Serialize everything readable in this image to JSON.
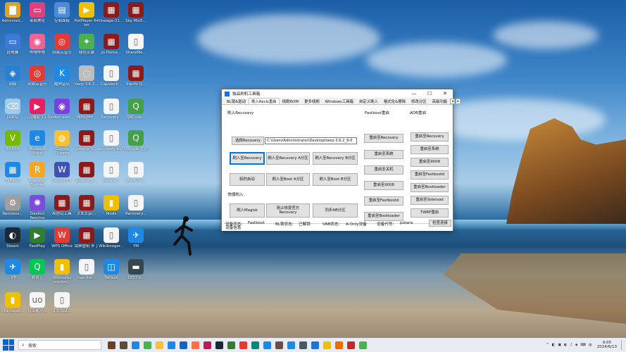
{
  "desktop": {
    "icons": [
      {
        "label": "Administr...",
        "color": "#e0a020",
        "glyph": "▇"
      },
      {
        "label": "桌面美化",
        "color": "#e04080",
        "glyph": "▭"
      },
      {
        "label": "控制面板",
        "color": "#4a8ad8",
        "glyph": "▤"
      },
      {
        "label": "PotPlayer 64 bit",
        "color": "#f0c000",
        "glyph": "▶"
      },
      {
        "label": "lineage-21...",
        "color": "#8b1a1a",
        "glyph": "▦"
      },
      {
        "label": "Sky Mix5...",
        "color": "#8b1a1a",
        "glyph": "▦"
      },
      {
        "label": "此电脑",
        "color": "#3a7bd5",
        "glyph": "▭"
      },
      {
        "label": "哔哩哔哩",
        "color": "#f06292",
        "glyph": "◉"
      },
      {
        "label": "网易云音乐",
        "color": "#e53935",
        "glyph": "◎"
      },
      {
        "label": "绿色安装",
        "color": "#4caf50",
        "glyph": "✦"
      },
      {
        "label": "pl.Home...",
        "color": "#8b1a1a",
        "glyph": "▦"
      },
      {
        "label": "ShareMe...",
        "color": "#f5f5f5",
        "glyph": "▯"
      },
      {
        "label": "网络",
        "color": "#2a7fd4",
        "glyph": "◈"
      },
      {
        "label": "网易云音乐",
        "color": "#e53935",
        "glyph": "◎"
      },
      {
        "label": "酷狗音乐",
        "color": "#1e88e5",
        "glyph": "K"
      },
      {
        "label": "twrp-3.6.2...",
        "color": "#bdbdbd",
        "glyph": "◌"
      },
      {
        "label": "Capslock...",
        "color": "#f5f5f5",
        "glyph": "▯"
      },
      {
        "label": "Xtprfd Q...",
        "color": "#8b1a1a",
        "glyph": "▦"
      },
      {
        "label": "回收站",
        "color": "#9ecbf2",
        "glyph": "⌫"
      },
      {
        "label": "万兴喵影 11.0",
        "color": "#e91e63",
        "glyph": "▶"
      },
      {
        "label": "video-xsm...",
        "color": "#7b3fe4",
        "glyph": "◉"
      },
      {
        "label": "MJPA(MH...",
        "color": "#8b1a1a",
        "glyph": "▦"
      },
      {
        "label": "Recovery...",
        "color": "#f5f5f5",
        "glyph": "▯"
      },
      {
        "label": "QRCode...",
        "color": "#43a047",
        "glyph": "Q"
      },
      {
        "label": "NVIDIA",
        "color": "#76b900",
        "glyph": "V"
      },
      {
        "label": "Microsoft Edge",
        "color": "#1e88e5",
        "glyph": "e"
      },
      {
        "label": "Google Chrome",
        "color": "#fbc02d",
        "glyph": "◍"
      },
      {
        "label": "polaris_b...",
        "color": "#8b1a1a",
        "glyph": "▦"
      },
      {
        "label": "accomfonts...",
        "color": "#f5f5f5",
        "glyph": "▯"
      },
      {
        "label": "QRCode 图片",
        "color": "#43a047",
        "glyph": "Q"
      },
      {
        "label": "FaBlock",
        "color": "#1e88e5",
        "glyph": "▦"
      },
      {
        "label": "Rockstar Games",
        "color": "#f5a623",
        "glyph": "R"
      },
      {
        "label": "Word/PPT",
        "color": "#3f51b5",
        "glyph": "W"
      },
      {
        "label": "polaris_b...",
        "color": "#8b1a1a",
        "glyph": "▦"
      },
      {
        "label": "polaris...",
        "color": "#f5f5f5",
        "glyph": "▯"
      },
      {
        "label": "plotform...",
        "color": "#f5f5f5",
        "glyph": "▯"
      },
      {
        "label": "Remotes...",
        "color": "#9e9e9e",
        "glyph": "⚙"
      },
      {
        "label": "Davinci Resolve",
        "color": "#7b4bdc",
        "glyph": "✺"
      },
      {
        "label": "AI办公工具",
        "color": "#8b1a1a",
        "glyph": "▦"
      },
      {
        "label": "2.8.2.pr...",
        "color": "#8b1a1a",
        "glyph": "▦"
      },
      {
        "label": "Mods",
        "color": "#f0c000",
        "glyph": "▮"
      },
      {
        "label": "Recovery...",
        "color": "#f5f5f5",
        "glyph": "▯"
      },
      {
        "label": "Steam",
        "color": "#1b2838",
        "glyph": "◐"
      },
      {
        "label": "FastPlay",
        "color": "#2e7d32",
        "glyph": "▶"
      },
      {
        "label": "WPS Office",
        "color": "#e53935",
        "glyph": "W"
      },
      {
        "label": "锁屏壁纸 补丁",
        "color": "#8b1a1a",
        "glyph": "▦"
      },
      {
        "label": "Wikibooger...",
        "color": "#f5f5f5",
        "glyph": "▯"
      },
      {
        "label": "YM",
        "color": "#1e88e5",
        "glyph": "✈"
      },
      {
        "label": "飞书",
        "color": "#1e88e5",
        "glyph": "✈"
      },
      {
        "label": "爱奇艺",
        "color": "#00c853",
        "glyph": "Q"
      },
      {
        "label": "Wildcollei minibo...",
        "color": "#f0c000",
        "glyph": "▮"
      },
      {
        "label": "nao Sdr...",
        "color": "#f5f5f5",
        "glyph": "▯"
      },
      {
        "label": "ToDesk",
        "color": "#1e88e5",
        "glyph": "◫"
      },
      {
        "label": "1837-V...",
        "color": "#37474f",
        "glyph": "▬"
      },
      {
        "label": "ChatGeek...",
        "color": "#f0c000",
        "glyph": "▮"
      },
      {
        "label": "以上都开...",
        "color": "#f5f5f5",
        "glyph": "uo"
      },
      {
        "label": "2.0.2c2...",
        "color": "#f5f5f5",
        "glyph": "▯"
      }
    ]
  },
  "window": {
    "title": "独品刷机工具箱",
    "controls": {
      "minimize": "—",
      "maximize": "☐",
      "close": "✕"
    },
    "tabs": [
      "BL锁&驱动",
      "刷入Rec&重启",
      "线刷ROM",
      "更多线刷",
      "Windows工具箱",
      "自定义刷入",
      "格式化&擦除",
      "修改分区",
      "高级功能"
    ],
    "active_tab": 1,
    "arrows": [
      "◂",
      "▸"
    ],
    "sections": {
      "flash_recovery": "刷入Recovery",
      "quick_flash": "快捷刷入",
      "fastboot_reboot": "Fastboot重启",
      "adb_reboot": "ADB重启",
      "device_info": "设备信息"
    },
    "select_recovery_button": "选择Recovery",
    "recovery_path": "C:\\Users\\Administrator\\Desktop\\twrp-3.6.2_9-0",
    "flash_buttons": [
      "刷入至Recovery",
      "刷入至Recovery A分区",
      "刷入至Recovery B分区",
      "临时启动",
      "刷入至Boot A分区",
      "刷入至Boot B分区"
    ],
    "quick_buttons": [
      "刷入Magisk",
      "阻止恢复官方Recovery",
      "同步AB分区"
    ],
    "fastboot_buttons": [
      "重启至Recovery",
      "重启至系统",
      "重启至关机",
      "重启至9008",
      "重启至Fastbootd",
      "重启至Bootloader"
    ],
    "adb_buttons": [
      "重启至Recovery",
      "重启至系统",
      "重启至9008",
      "重启至Fastbootd",
      "重启至Bootloader",
      "重启至Sideload",
      "TWRP重启"
    ],
    "device": {
      "status_label": "设备状态:",
      "status_value": "Fastboot",
      "bl_label": "BL锁状态:",
      "bl_value": "已解锁",
      "vab_label": "VAB状态:",
      "vab_value": "A-Only设备",
      "code_label": "设备代号:",
      "code_value": "polaris",
      "check_button": "检查连接"
    }
  },
  "taskbar": {
    "search_placeholder": "搜索",
    "time": "9:05",
    "date": "2024/6/13",
    "app_colors": [
      "#6b3f1f",
      "#5a4a3a",
      "#1e88e5",
      "#4caf50",
      "#fbc02d",
      "#1e88e5",
      "#1565c0",
      "#ff7043",
      "#c2185b",
      "#1b2838",
      "#2e7d32",
      "#e53935",
      "#00897b",
      "#1e88e5",
      "#6d4c41",
      "#1e88e5",
      "#455a64",
      "#1976d2",
      "#f0c000",
      "#ef6c00",
      "#c62828",
      "#4caf50"
    ],
    "tray_glyphs": [
      "^",
      "◧",
      "▣",
      "◐",
      "♪",
      "◈",
      "⌨",
      "中"
    ]
  }
}
